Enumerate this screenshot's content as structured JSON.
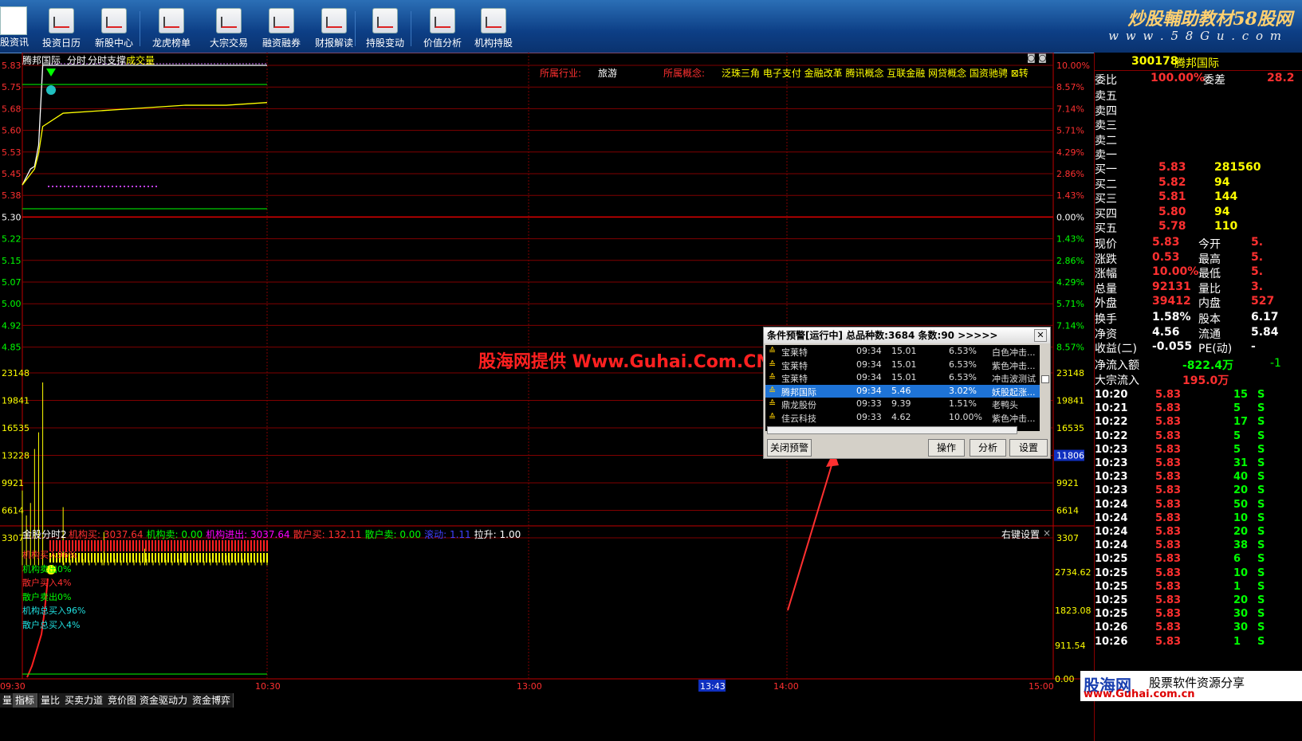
{
  "toolbar": {
    "first_label": "股资讯",
    "items": [
      "投资日历",
      "新股中心",
      "龙虎榜单",
      "大宗交易",
      "融资融券",
      "财报解读",
      "持股变动",
      "价值分析",
      "机构持股"
    ],
    "brand_title": "炒股輔助教材58股网",
    "brand_url": "w w w . 5 8 G u . c o m"
  },
  "chart_header": {
    "stock_name": "腾邦国际",
    "tabs": [
      "分时",
      "分时支撑"
    ],
    "volume_label": "成交量",
    "industry_label": "所属行业:",
    "industry_value": "旅游",
    "concept_label": "所属概念:",
    "concept_value": "泛珠三角 电子支付 金融改革 腾讯概念 互联金融 网贷概念 国资驰骋 ⊠转"
  },
  "price_axis": {
    "left": [
      "5.83",
      "5.75",
      "5.68",
      "5.60",
      "5.53",
      "5.45",
      "5.38",
      "5.30",
      "5.22",
      "5.15",
      "5.07",
      "5.00",
      "4.92",
      "4.85"
    ],
    "right": [
      "10.00%",
      "8.57%",
      "7.14%",
      "5.71%",
      "4.29%",
      "2.86%",
      "1.43%",
      "0.00%",
      "1.43%",
      "2.86%",
      "4.29%",
      "5.71%",
      "7.14%",
      "8.57%"
    ]
  },
  "volume_axis": {
    "left": [
      "23148",
      "19841",
      "16535",
      "13228",
      "9921",
      "6614",
      "3307"
    ],
    "right": [
      "23148",
      "19841",
      "16535",
      "11806",
      "9921",
      "6614",
      "3307"
    ]
  },
  "indicator": {
    "title": "金股分时2",
    "items": [
      {
        "label": "机构买:",
        "value": "3037.64",
        "color": "#ff3030"
      },
      {
        "label": "机构卖:",
        "value": "0.00",
        "color": "#00ff00"
      },
      {
        "label": "机构进出:",
        "value": "3037.64",
        "color": "#ff00ff"
      },
      {
        "label": "散户买:",
        "value": "132.11",
        "color": "#ff3030"
      },
      {
        "label": "散户卖:",
        "value": "0.00",
        "color": "#00ff00"
      },
      {
        "label": "滚动:",
        "value": "1.11",
        "color": "#4040ff"
      },
      {
        "label": "拉升:",
        "value": "1.00",
        "color": "#ffffff"
      }
    ],
    "settings_label": "右键设置",
    "close_glyph": "×",
    "notes": [
      "机构买入96%",
      "机构卖出0%",
      "散户买入4%",
      "散户卖出0%",
      "机构总买入96%",
      "散户总买入4%"
    ],
    "axis_right": [
      "2734.62",
      "1823.08",
      "911.54",
      "0.00"
    ]
  },
  "time_axis": [
    "09:30",
    "10:30",
    "13:00",
    "13:43",
    "14:00",
    "15:00"
  ],
  "chart_data": {
    "type": "line",
    "x": [
      "09:30",
      "09:31",
      "09:32",
      "09:33",
      "09:34",
      "09:35",
      "09:40",
      "09:50",
      "10:00",
      "10:10",
      "10:20",
      "10:30"
    ],
    "series": [
      {
        "name": "",
        "values": [
          5.38,
          5.41,
          5.44,
          5.45,
          5.53,
          5.83,
          5.83,
          5.83,
          5.83,
          5.83,
          5.83,
          5.83
        ]
      },
      {
        "name": "",
        "values": [
          5.38,
          5.4,
          5.42,
          5.44,
          5.5,
          5.6,
          5.65,
          5.66,
          5.67,
          5.68,
          5.68,
          5.69
        ]
      }
    ],
    "volume": [
      9000,
      6000,
      7500,
      14000,
      16000,
      22000,
      7000,
      4000,
      2000,
      1500,
      1200,
      1000
    ],
    "ylim": [
      4.77,
      5.83
    ],
    "prev_close": 5.3
  },
  "quote_panel": {
    "code": "300178",
    "name": "腾邦国际",
    "weibi_label": "委比",
    "weibi_value": "100.00%",
    "weicha_label": "委差",
    "weicha_value": "28.2",
    "sells": [
      "卖五",
      "卖四",
      "卖三",
      "卖二",
      "卖一"
    ],
    "buys": [
      {
        "label": "买一",
        "price": "5.83",
        "vol": "281560"
      },
      {
        "label": "买二",
        "price": "5.82",
        "vol": "94"
      },
      {
        "label": "买三",
        "price": "5.81",
        "vol": "144"
      },
      {
        "label": "买四",
        "price": "5.80",
        "vol": "94"
      },
      {
        "label": "买五",
        "price": "5.78",
        "vol": "110"
      }
    ],
    "stats": [
      {
        "l1": "现价",
        "v1": "5.83",
        "l2": "今开",
        "v2": "5."
      },
      {
        "l1": "涨跌",
        "v1": "0.53",
        "l2": "最高",
        "v2": "5."
      },
      {
        "l1": "涨幅",
        "v1": "10.00%",
        "l2": "最低",
        "v2": "5."
      },
      {
        "l1": "总量",
        "v1": "92131",
        "l2": "量比",
        "v2": "3."
      },
      {
        "l1": "外盘",
        "v1": "39412",
        "l2": "内盘",
        "v2": "527"
      }
    ],
    "stats2": [
      {
        "l1": "换手",
        "v1": "1.58%",
        "l2": "股本",
        "v2": "6.17"
      },
      {
        "l1": "净资",
        "v1": "4.56",
        "l2": "流通",
        "v2": "5.84"
      },
      {
        "l1": "收益(二)",
        "v1": "-0.055",
        "l2": "PE(动)",
        "v2": "-"
      }
    ],
    "flow": [
      {
        "label": "净流入额",
        "value": "-822.4万",
        "extra": "-1"
      },
      {
        "label": "大宗流入",
        "value": "195.0万",
        "extra": ""
      }
    ],
    "ticks": [
      [
        "10:20",
        "5.83",
        "15",
        "S"
      ],
      [
        "10:21",
        "5.83",
        "5",
        "S"
      ],
      [
        "10:22",
        "5.83",
        "17",
        "S"
      ],
      [
        "10:22",
        "5.83",
        "5",
        "S"
      ],
      [
        "10:23",
        "5.83",
        "5",
        "S"
      ],
      [
        "10:23",
        "5.83",
        "31",
        "S"
      ],
      [
        "10:23",
        "5.83",
        "40",
        "S"
      ],
      [
        "10:23",
        "5.83",
        "20",
        "S"
      ],
      [
        "10:24",
        "5.83",
        "50",
        "S"
      ],
      [
        "10:24",
        "5.83",
        "10",
        "S"
      ],
      [
        "10:24",
        "5.83",
        "20",
        "S"
      ],
      [
        "10:24",
        "5.83",
        "38",
        "S"
      ],
      [
        "10:25",
        "5.83",
        "6",
        "S"
      ],
      [
        "10:25",
        "5.83",
        "10",
        "S"
      ],
      [
        "10:25",
        "5.83",
        "1",
        "S"
      ],
      [
        "10:25",
        "5.83",
        "20",
        "S"
      ],
      [
        "10:25",
        "5.83",
        "30",
        "S"
      ],
      [
        "10:26",
        "5.83",
        "30",
        "S"
      ],
      [
        "10:26",
        "5.83",
        "1",
        "S"
      ]
    ]
  },
  "dialog": {
    "title": "条件预警[运行中] 总品种数:3684 条数:90  >>>>>",
    "rows": [
      [
        "宝莱特",
        "09:34",
        "15.01",
        "6.53%",
        "白色冲击..."
      ],
      [
        "宝莱特",
        "09:34",
        "15.01",
        "6.53%",
        "紫色冲击..."
      ],
      [
        "宝莱特",
        "09:34",
        "15.01",
        "6.53%",
        "冲击波测试"
      ],
      [
        "腾邦国际",
        "09:34",
        "5.46",
        "3.02%",
        "妖股起涨..."
      ],
      [
        "鼎龙股份",
        "09:33",
        "9.39",
        "1.51%",
        "老鸭头"
      ],
      [
        "佳云科技",
        "09:33",
        "4.62",
        "10.00%",
        "紫色冲击..."
      ]
    ],
    "btn_close": "关闭预警",
    "btn_op": "操作",
    "btn_analyze": "分析",
    "btn_settings": "设置"
  },
  "watermark": "股海网提供 Www.Guhai.Com.CN",
  "bottom_tabs": [
    "量",
    "指标",
    "量比",
    "买卖力道",
    "竞价图",
    "资金驱动力",
    "资金博弈"
  ],
  "footer_brand": {
    "name": "股海网",
    "slogan": "股票软件资源分享",
    "url": "www.Guhai.com.cn"
  }
}
